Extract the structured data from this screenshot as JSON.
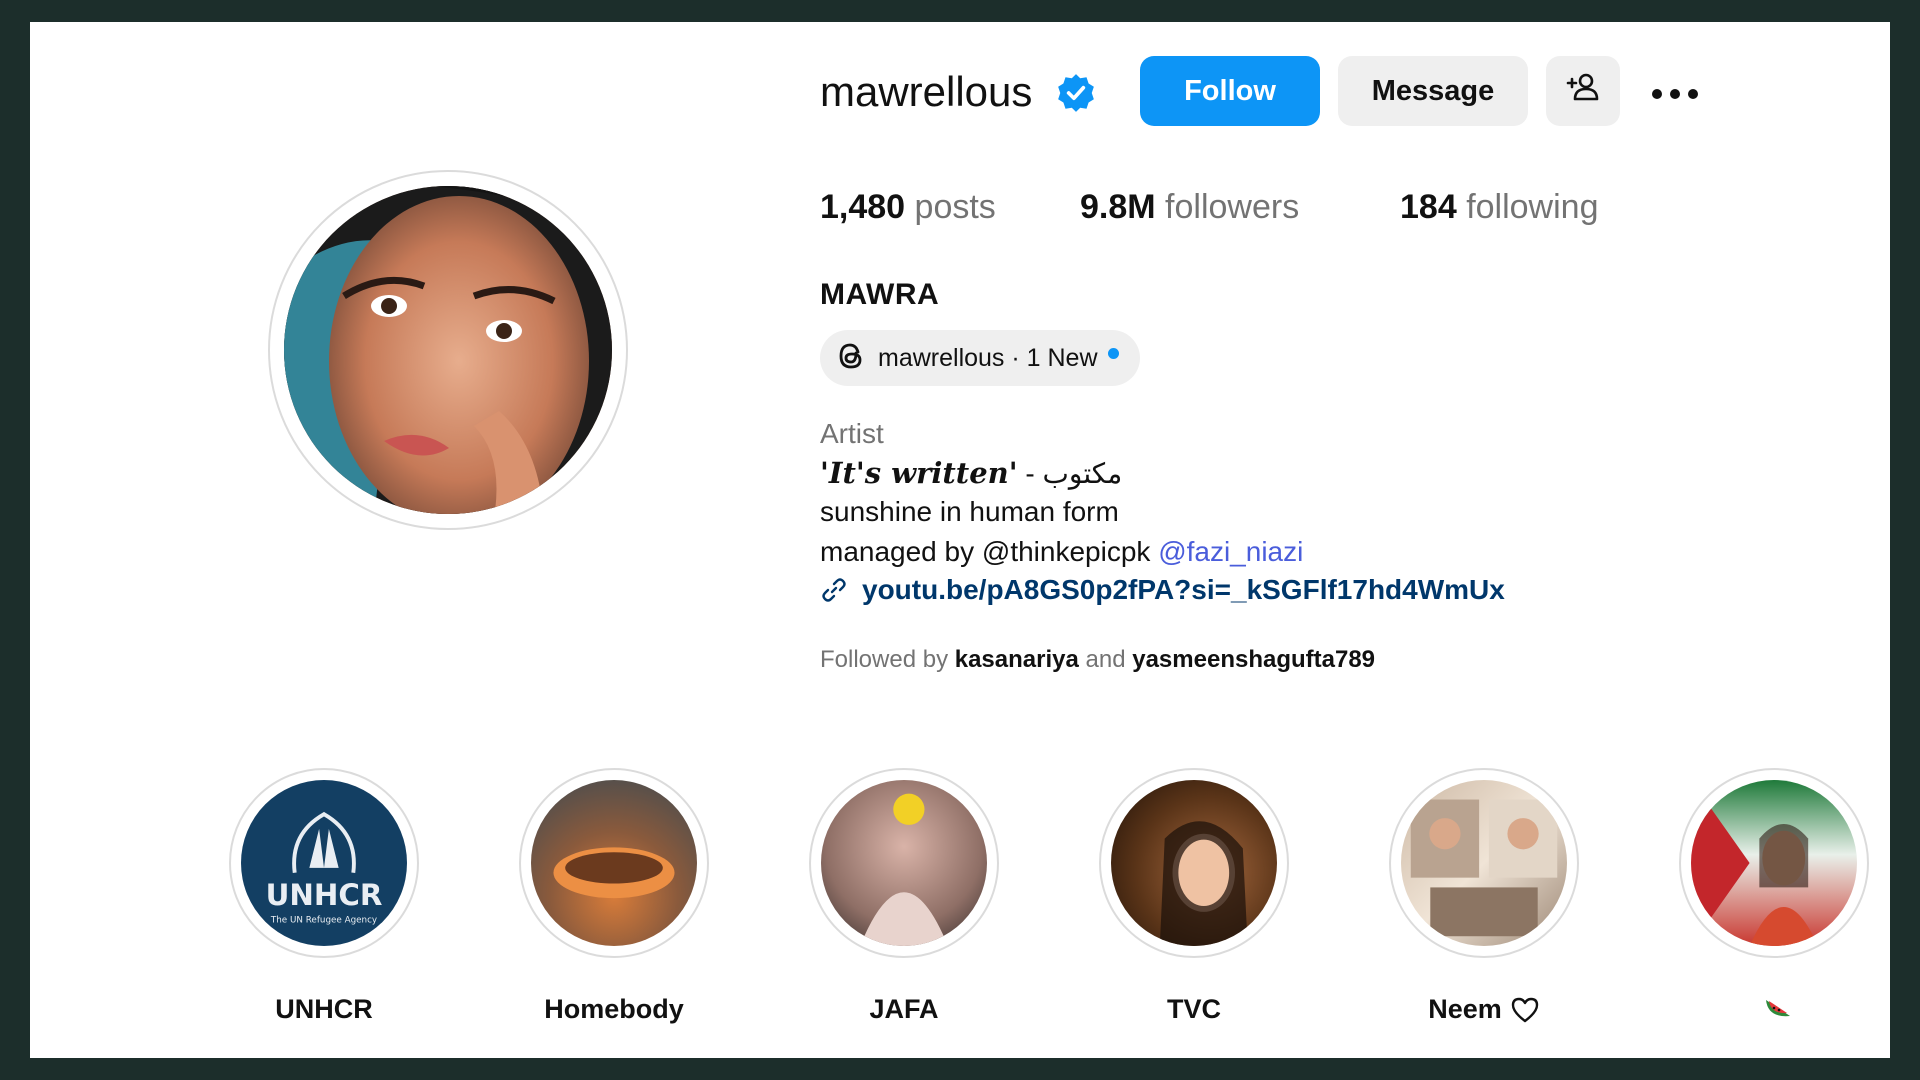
{
  "profile": {
    "username": "mawrellous",
    "verified": true,
    "display_name": "MAWRA",
    "avatar": "profile-photo"
  },
  "actions": {
    "follow_label": "Follow",
    "message_label": "Message",
    "add_user_icon": "add-user-icon",
    "more_icon": "more-options-icon"
  },
  "stats": {
    "posts_count": "1,480",
    "posts_label": "posts",
    "followers_count": "9.8M",
    "followers_label": "followers",
    "following_count": "184",
    "following_label": "following"
  },
  "threads": {
    "icon": "threads-icon",
    "label": "mawrellous · 1 New"
  },
  "bio": {
    "category": "Artist",
    "quote_latin": "'It's written'",
    "quote_sep": " - ",
    "quote_arabic": "مكتوب",
    "line2": "sunshine in human form",
    "managed_prefix": "managed by @thinkepicpk ",
    "managed_mention": "@fazi_niazi",
    "link_icon": "link-icon",
    "link": "youtu.be/pA8GS0p2fPA?si=_kSGFlf17hd4WmUx"
  },
  "followed_by": {
    "prefix": "Followed by ",
    "user1": "kasanariya",
    "conj": " and ",
    "user2": "yasmeenshagufta789"
  },
  "highlights": [
    {
      "label": "UNHCR",
      "icon": ""
    },
    {
      "label": "Homebody",
      "icon": ""
    },
    {
      "label": "JAFA",
      "icon": ""
    },
    {
      "label": "TVC",
      "icon": ""
    },
    {
      "label": "Neem",
      "icon": "heart-icon"
    },
    {
      "label": "",
      "icon": "watermelon-icon"
    }
  ],
  "colors": {
    "follow_blue": "#0d95f6",
    "link_blue": "#00376b",
    "mention_blue": "#4a5ddb",
    "frame": "#1c2e2b"
  }
}
